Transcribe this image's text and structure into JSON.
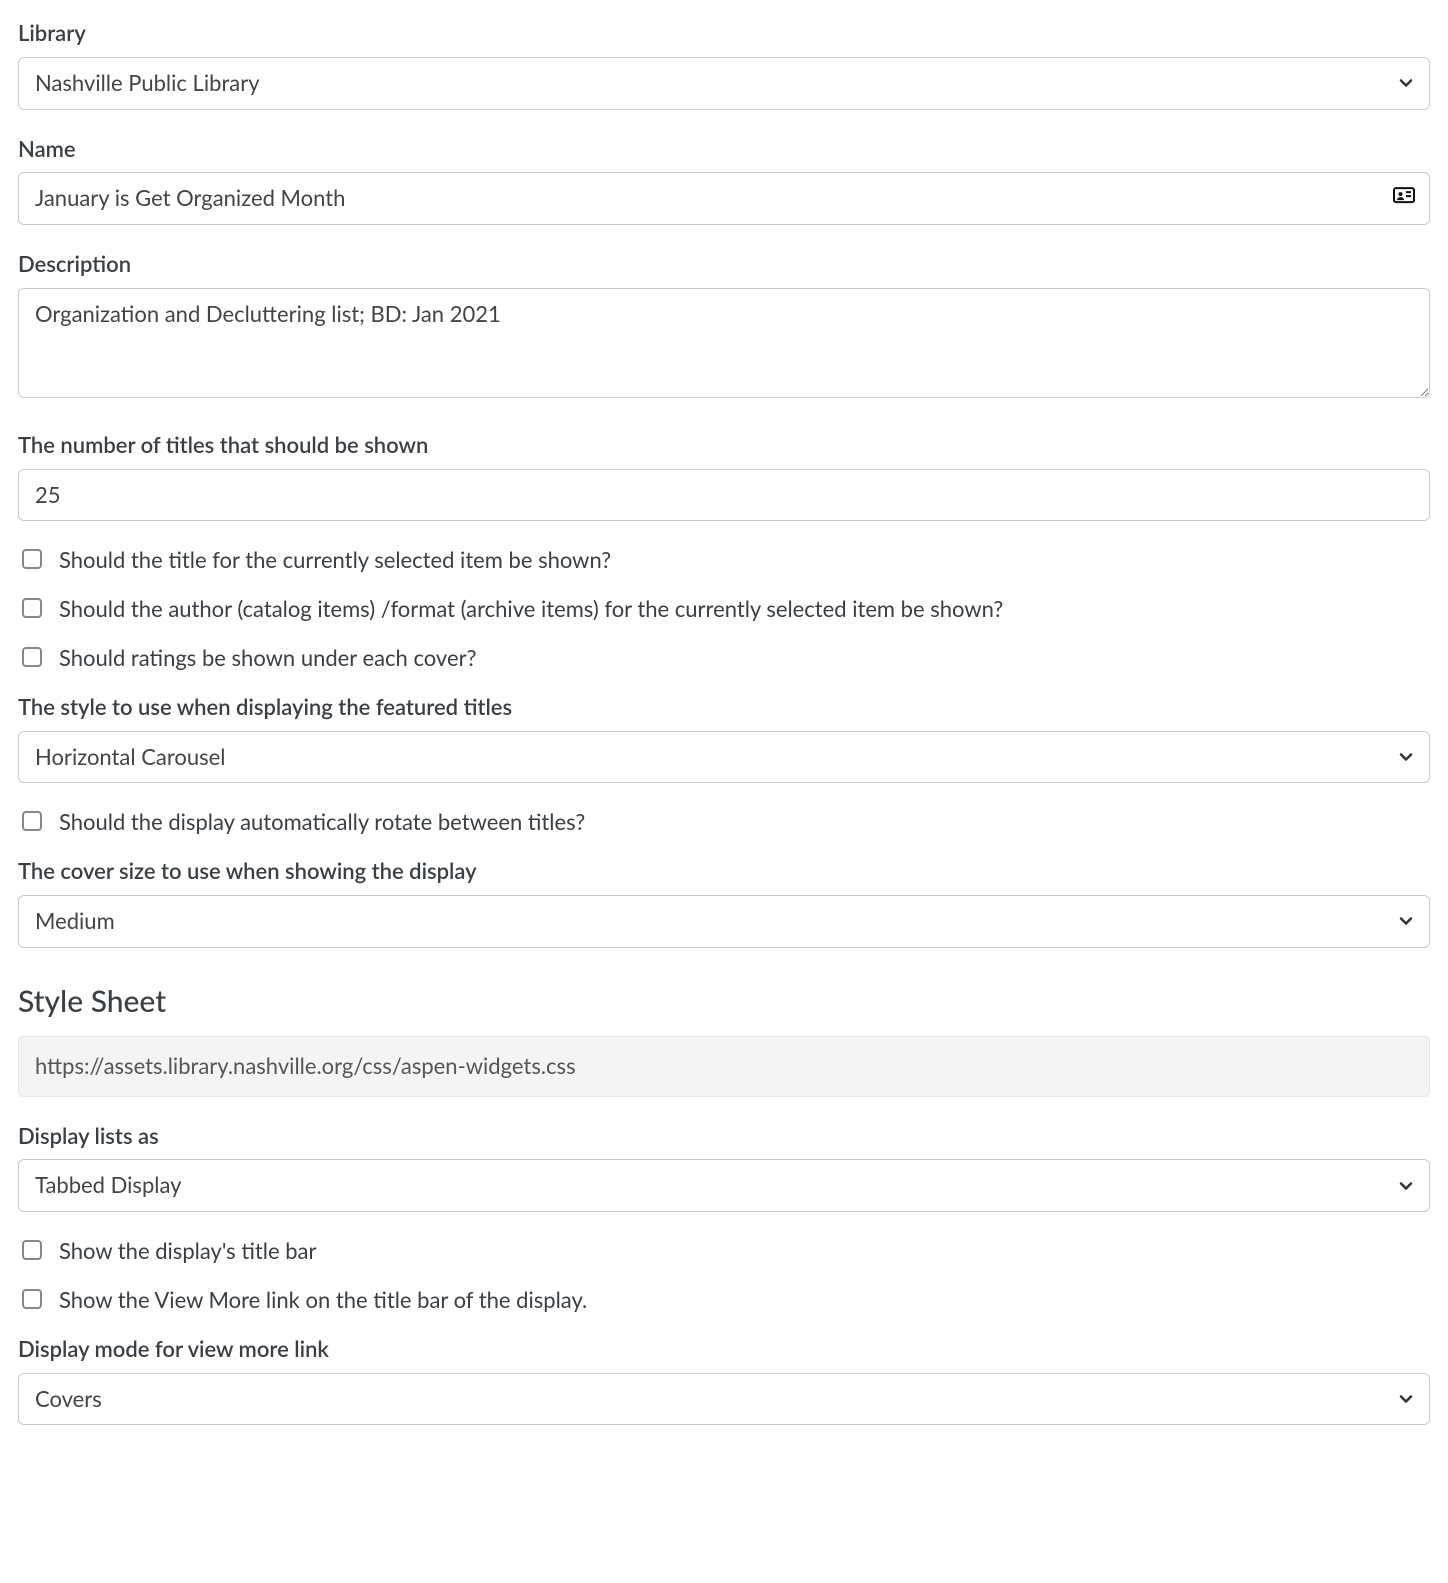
{
  "library": {
    "label": "Library",
    "value": "Nashville Public Library"
  },
  "name": {
    "label": "Name",
    "value": "January is Get Organized Month"
  },
  "description": {
    "label": "Description",
    "value": "Organization and Decluttering list; BD: Jan 2021"
  },
  "num_titles": {
    "label": "The number of titles that should be shown",
    "value": "25"
  },
  "cb_show_title": {
    "label": "Should the title for the currently selected item be shown?"
  },
  "cb_show_author": {
    "label": "Should the author (catalog items) /format (archive items) for the currently selected item be shown?"
  },
  "cb_show_ratings": {
    "label": "Should ratings be shown under each cover?"
  },
  "style": {
    "label": "The style to use when displaying the featured titles",
    "value": "Horizontal Carousel"
  },
  "cb_auto_rotate": {
    "label": "Should the display automatically rotate between titles?"
  },
  "cover_size": {
    "label": "The cover size to use when showing the display",
    "value": "Medium"
  },
  "stylesheet": {
    "heading": "Style Sheet",
    "value": "https://assets.library.nashville.org/css/aspen-widgets.css"
  },
  "display_lists_as": {
    "label": "Display lists as",
    "value": "Tabbed Display"
  },
  "cb_show_title_bar": {
    "label": "Show the display's title bar"
  },
  "cb_show_view_more": {
    "label": "Show the View More link on the title bar of the display."
  },
  "view_more_mode": {
    "label": "Display mode for view more link",
    "value": "Covers"
  }
}
